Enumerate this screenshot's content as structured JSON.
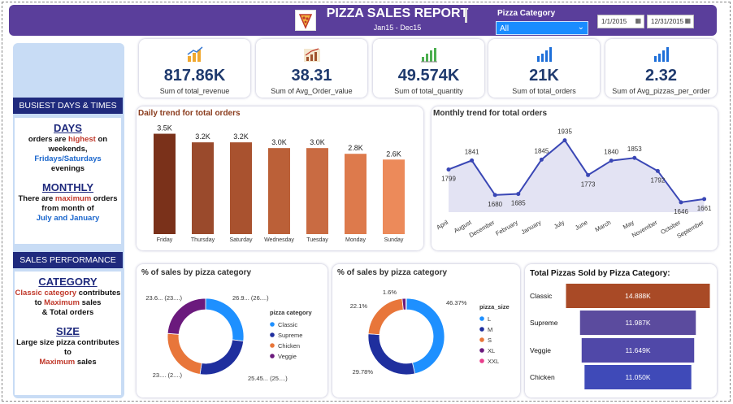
{
  "header": {
    "title": "PIZZA SALES REPORT",
    "subtitle": "Jan15 - Dec15",
    "category_label": "Pizza Category",
    "category_value": "All",
    "date_from": "1/1/2015",
    "date_to": "12/31/2015"
  },
  "left": {
    "busiest_header": "BUSIEST DAYS & TIMES",
    "days_heading": "DAYS",
    "days_line1_a": "orders are ",
    "days_line1_b": "highest",
    "days_line1_c": " on",
    "days_line2": "weekends,",
    "days_line3": "Fridays/Saturdays",
    "days_line4": "evenings",
    "monthly_heading": "MONTHLY",
    "monthly_line1_a": "There are ",
    "monthly_line1_b": "maximum",
    "monthly_line1_c": " orders",
    "monthly_line2": "from month of",
    "monthly_line3": "July and January",
    "sales_header": "SALES PERFORMANCE",
    "category_heading": "CATEGORY",
    "cat_line1_a": "Classic category",
    "cat_line1_b": " contributes",
    "cat_line2_a": "to ",
    "cat_line2_b": "Maximum",
    "cat_line2_c": " sales",
    "cat_line3": "& Total orders",
    "size_heading": "SIZE",
    "size_line1": "Large size pizza contributes",
    "size_line2": "to",
    "size_line3": "Maximum",
    "size_line3_b": " sales"
  },
  "kpis": [
    {
      "value": "817.86K",
      "label": "Sum of total_revenue",
      "icon": "revenue-chart-icon"
    },
    {
      "value": "38.31",
      "label": "Sum of Avg_Order_value",
      "icon": "growth-chart-icon"
    },
    {
      "value": "49.574K",
      "label": "Sum of total_quantity",
      "icon": "quantity-chart-icon"
    },
    {
      "value": "21K",
      "label": "Sum of total_orders",
      "icon": "bar-chart-icon"
    },
    {
      "value": "2.32",
      "label": "Sum of Avg_pizzas_per_order",
      "icon": "bar-chart-icon"
    }
  ],
  "colors": {
    "header": "#5a3e9b",
    "navy": "#1f2a7d",
    "line": "#3a47b5",
    "classic": "#1e90ff",
    "supreme": "#1f2f9e",
    "chicken": "#e8763a",
    "veggie": "#6b1a7d"
  },
  "chart_data": [
    {
      "type": "bar",
      "title": "Daily trend for total orders",
      "categories": [
        "Friday",
        "Thursday",
        "Saturday",
        "Wednesday",
        "Tuesday",
        "Monday",
        "Sunday"
      ],
      "values": [
        3.5,
        3.2,
        3.2,
        3.0,
        3.0,
        2.8,
        2.6
      ],
      "labels": [
        "3.5K",
        "3.2K",
        "3.2K",
        "3.0K",
        "3.0K",
        "2.8K",
        "2.6K"
      ],
      "colors": [
        "#7a311a",
        "#9a4a2c",
        "#a9522f",
        "#bb6038",
        "#c96b42",
        "#dd7a4c",
        "#ec8a5a"
      ]
    },
    {
      "type": "area",
      "title": "Monthly trend for total orders",
      "categories": [
        "April",
        "August",
        "December",
        "February",
        "January",
        "July",
        "June",
        "March",
        "May",
        "November",
        "October",
        "September"
      ],
      "values": [
        1799,
        1841,
        1680,
        1685,
        1845,
        1935,
        1773,
        1840,
        1853,
        1792,
        1646,
        1661
      ],
      "ylim": [
        1600,
        1960
      ]
    },
    {
      "type": "pie",
      "title": "% of sales by pizza category",
      "legend_title": "pizza category",
      "legend_placement": "right",
      "slices": [
        {
          "name": "Classic",
          "value": 26.9,
          "label": "26.9... (26....)",
          "color": "#1e90ff"
        },
        {
          "name": "Supreme",
          "value": 25.45,
          "label": "25.45... (25....)",
          "color": "#1f2f9e"
        },
        {
          "name": "Chicken",
          "value": 23.95,
          "label": "23.... (2....)",
          "color": "#e8763a"
        },
        {
          "name": "Veggie",
          "value": 23.7,
          "label": "23.6... (23....)",
          "color": "#6b1a7d"
        }
      ]
    },
    {
      "type": "pie",
      "title": "% of sales by pizza category",
      "legend_title": "pizza_size",
      "legend_placement": "right",
      "slices": [
        {
          "name": "L",
          "value": 46.37,
          "label": "46.37%",
          "color": "#1e90ff"
        },
        {
          "name": "M",
          "value": 29.78,
          "label": "29.78%",
          "color": "#1f2f9e"
        },
        {
          "name": "S",
          "value": 22.1,
          "label": "22.1%",
          "color": "#e8763a"
        },
        {
          "name": "XL",
          "value": 1.6,
          "label": "1.6%",
          "color": "#6b1a7d"
        },
        {
          "name": "XXL",
          "value": 0.15,
          "label": "",
          "color": "#e83e8c"
        }
      ]
    },
    {
      "type": "bar",
      "title": "Total Pizzas Sold by Pizza Category:",
      "categories": [
        "Classic",
        "Supreme",
        "Veggie",
        "Chicken"
      ],
      "values": [
        14.888,
        11.987,
        11.649,
        11.05
      ],
      "labels": [
        "14.888K",
        "11.987K",
        "11.649K",
        "11.050K"
      ],
      "colors": [
        "#a94a26",
        "#5b4b9e",
        "#5048a8",
        "#3f4ab8"
      ]
    }
  ]
}
